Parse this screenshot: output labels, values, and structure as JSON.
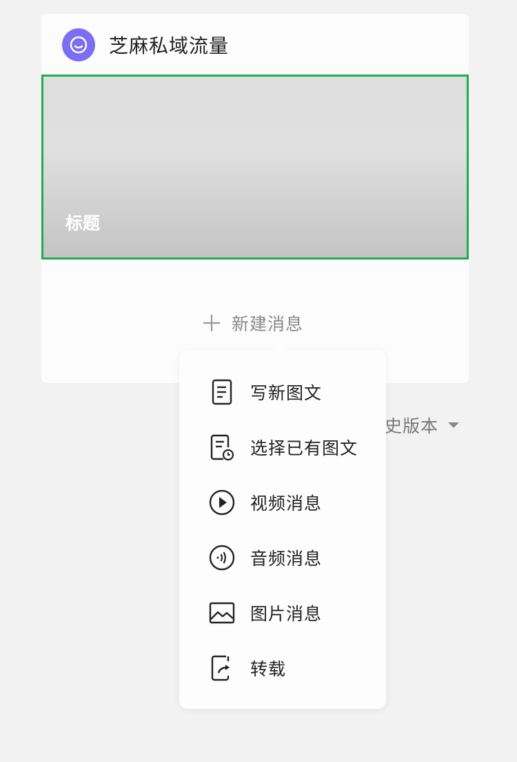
{
  "account": {
    "name": "芝麻私域流量",
    "avatar_color": "#7b6ef2"
  },
  "article_cover": {
    "title": "标题",
    "border_color": "#1dac4f"
  },
  "new_message": {
    "label": "新建消息"
  },
  "history_version": {
    "label": "史版本"
  },
  "menu": {
    "items": [
      {
        "label": "写新图文",
        "icon": "document-icon"
      },
      {
        "label": "选择已有图文",
        "icon": "document-clock-icon"
      },
      {
        "label": "视频消息",
        "icon": "play-circle-icon"
      },
      {
        "label": "音频消息",
        "icon": "audio-circle-icon"
      },
      {
        "label": "图片消息",
        "icon": "image-icon"
      },
      {
        "label": "转载",
        "icon": "share-icon"
      }
    ]
  }
}
